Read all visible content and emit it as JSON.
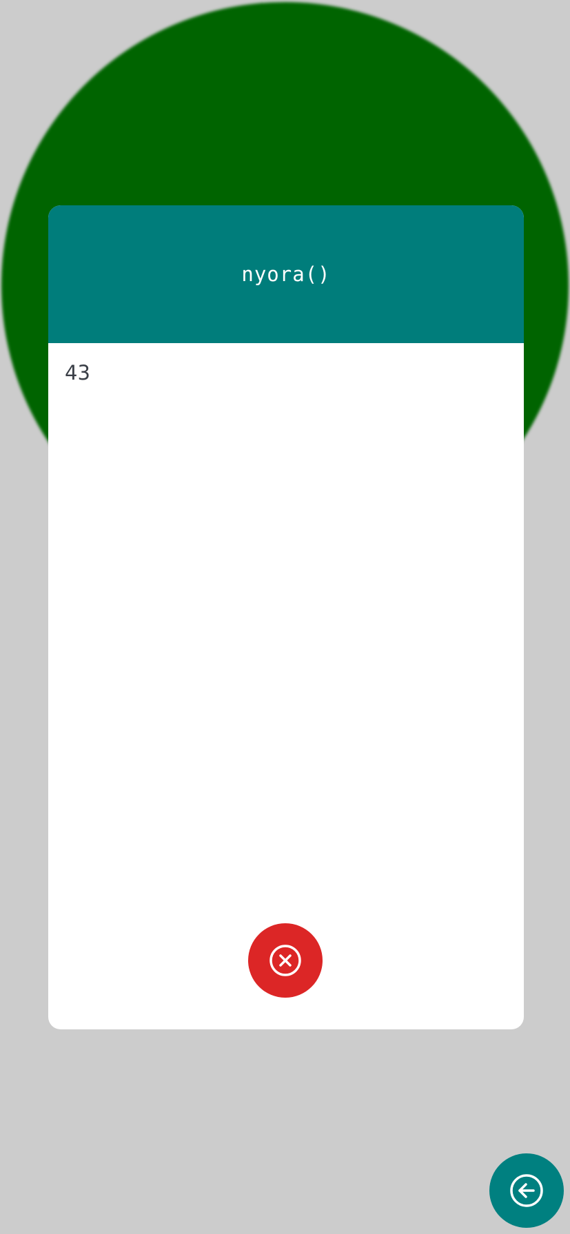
{
  "dialog": {
    "title": "nyora()",
    "body": "43",
    "close_icon": "close-circle-icon"
  },
  "back_button": {
    "icon": "arrow-left-circle-icon"
  },
  "colors": {
    "background": "#cccccc",
    "circle": "#006400",
    "header": "#007d7b",
    "close_button": "#dc2626",
    "back_button": "#008080"
  }
}
